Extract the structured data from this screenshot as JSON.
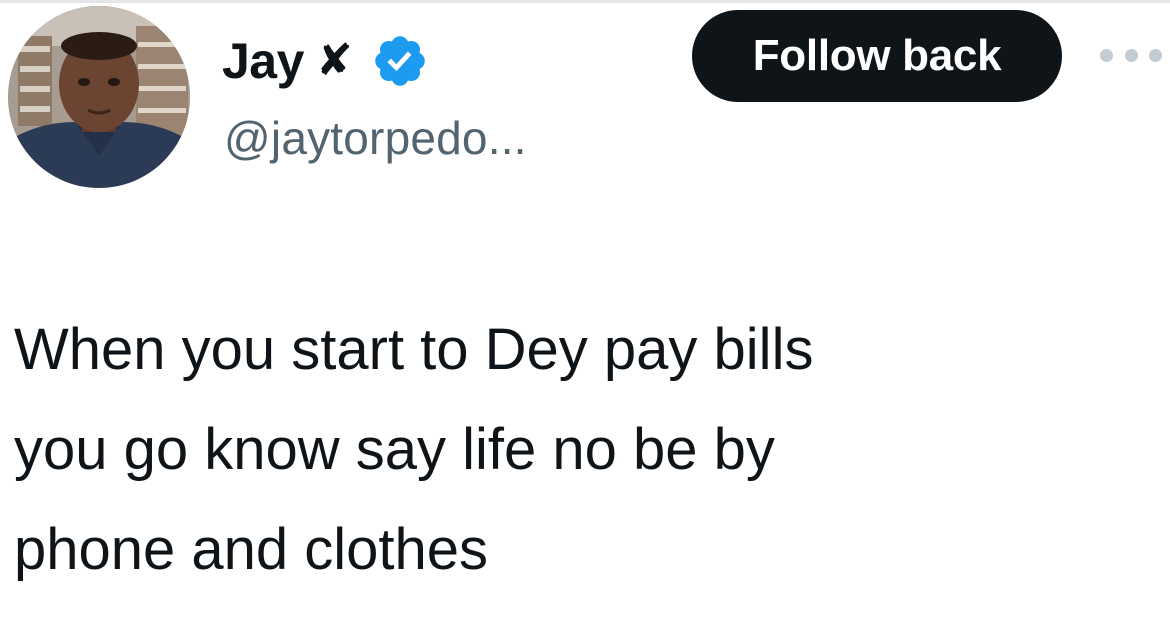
{
  "author": {
    "display_name": "Jay",
    "name_suffix": "✘",
    "handle": "@jaytorpedo...",
    "verified": true,
    "verified_color": "#1d9bf0"
  },
  "actions": {
    "follow_label": "Follow back",
    "more_icon": "more-horizontal-icon"
  },
  "tweet": {
    "lines": [
      "When you start to Dey pay bills",
      "you go know say life no be by",
      "phone and clothes"
    ]
  },
  "colors": {
    "text": "#0f1419",
    "secondary": "#536471",
    "button_bg": "#0f1419",
    "button_text": "#ffffff"
  }
}
